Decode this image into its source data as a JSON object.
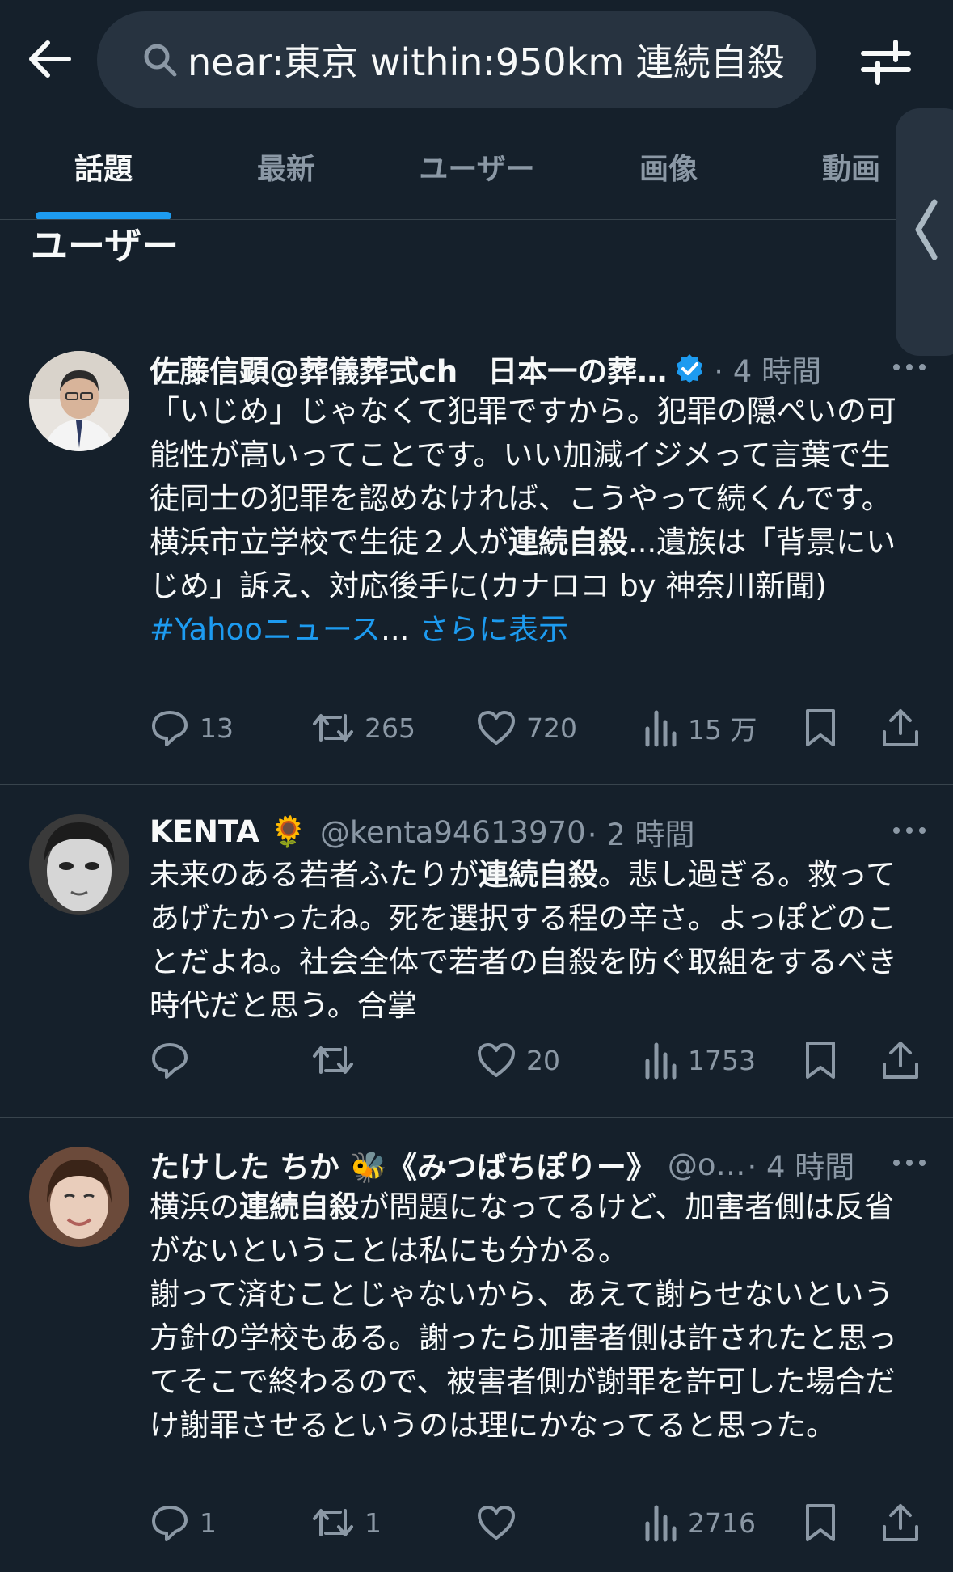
{
  "search": {
    "value": "near:東京 within:950km 連続自殺",
    "placeholder": ""
  },
  "tabs": [
    {
      "label": "話題",
      "active": true
    },
    {
      "label": "最新",
      "active": false
    },
    {
      "label": "ユーザー",
      "active": false
    },
    {
      "label": "画像",
      "active": false
    },
    {
      "label": "動画",
      "active": false
    }
  ],
  "section": {
    "title": "ユーザー"
  },
  "tweets": [
    {
      "name": "佐藤信顕@葬儀葬式ch　日本一の葬…",
      "verified": true,
      "handle": "",
      "meta": "· 4 時間",
      "body": {
        "line1": "「いじめ」じゃなくて犯罪ですから。犯罪の隠ぺいの可能性が高いってことです。いい加減イジメって言葉で生徒同士の犯罪を認めなければ、こうやって続くんです。",
        "line2_pre": "横浜市立学校で生徒２人が",
        "line2_bold": "連続自殺",
        "line2_post": "...遺族は「背景にいじめ」訴え、対応後手に(カナロコ by 神奈川新聞)",
        "hashtag": "#Yahooニュース",
        "ellipsis": "... ",
        "show_more": "さらに表示"
      },
      "replies": "13",
      "retweets": "265",
      "likes": "720",
      "views": "15 万"
    },
    {
      "name": "KENTA 🌻",
      "verified": false,
      "handle": "@kenta94613970",
      "meta": "· 2 時間",
      "body": {
        "pre": "未来のある若者ふたりが",
        "bold": "連続自殺",
        "post": "。悲し過ぎる。救ってあげたかったね。死を選択する程の辛さ。よっぽどのことだよね。社会全体で若者の自殺を防ぐ取組をするべき時代だと思う。合掌"
      },
      "replies": "",
      "retweets": "",
      "likes": "20",
      "views": "1753"
    },
    {
      "name": "たけした ちか 🐝《みつばちぽりー》",
      "verified": false,
      "handle": "@o…",
      "meta": "· 4 時間",
      "body": {
        "pre": "横浜の",
        "bold": "連続自殺",
        "post": "が問題になってるけど、加害者側は反省がないということは私にも分かる。",
        "para2": "謝って済むことじゃないから、あえて謝らせないという方針の学校もある。謝ったら加害者側は許されたと思ってそこで終わるので、被害者側が謝罪を許可した場合だけ謝罪させるというのは理にかなってると思った。"
      },
      "replies": "1",
      "retweets": "1",
      "likes": "",
      "views": "2716"
    }
  ],
  "colors": {
    "background": "#15202b",
    "accent": "#1d9bf0",
    "muted": "#8b98a5",
    "divider": "#38444d"
  }
}
